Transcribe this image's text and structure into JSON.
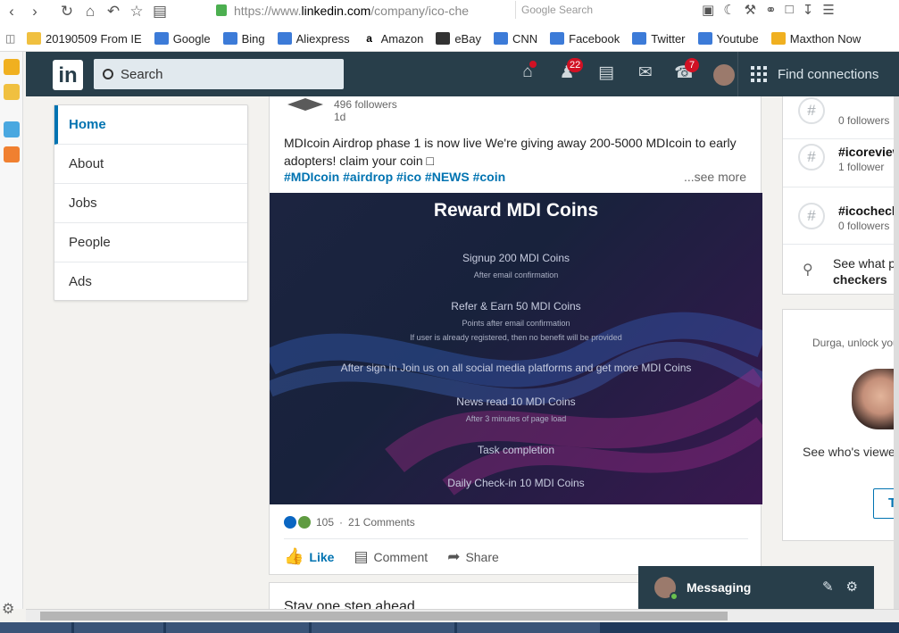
{
  "browser": {
    "url_proto": "https://www.",
    "url_host": "linkedin.com",
    "url_path": "/company/ico-che",
    "search_placeholder": "Google Search",
    "bookmarks": [
      "20190509 From IE",
      "Google",
      "Bing",
      "Aliexpress",
      "Amazon",
      "eBay",
      "CNN",
      "Facebook",
      "Twitter",
      "Youtube",
      "Maxthon Now"
    ]
  },
  "header": {
    "logo": "in",
    "search_placeholder": "Search",
    "network_badge": "22",
    "notifications_badge": "7",
    "find_connections": "Find connections"
  },
  "left_nav": {
    "items": [
      "Home",
      "About",
      "Jobs",
      "People",
      "Ads"
    ]
  },
  "post": {
    "followers": "496 followers",
    "time": "1d",
    "text": "MDIcoin Airdrop phase 1 is now live We're giving away 200-5000 MDIcoin to early adopters! claim your coin □",
    "hashtags": "#MDIcoin #airdrop #ico #NEWS #coin",
    "see_more": "...see more",
    "image": {
      "title": "Reward MDI Coins",
      "line1": "Signup 200 MDI Coins",
      "line1_sub": "After email confirmation",
      "line2": "Refer & Earn 50 MDI Coins",
      "line2_sub": "Points after email confirmation",
      "line2_sub2": "If user is already registered, then no benefit will be provided",
      "line3": "After sign in Join us on all social media platforms and get more MDI Coins",
      "line4": "News read 10 MDI Coins",
      "line4_sub": "After 3 minutes of page load",
      "line5": "Task completion",
      "line6": "Daily Check-in 10 MDI Coins"
    },
    "reactions": "105",
    "comments": "21 Comments",
    "like": "Like",
    "comment": "Comment",
    "share": "Share"
  },
  "stay_card": {
    "title": "Stay one step ahead"
  },
  "hashtag_card": {
    "items": [
      {
        "name": "",
        "sub": "0 followers"
      },
      {
        "name": "#icoreview",
        "sub": "1 follower"
      },
      {
        "name": "#icochecke",
        "sub": "0 followers"
      }
    ],
    "see_what_1": "See what p",
    "see_what_2": "checkers"
  },
  "ad_card": {
    "unlock_text": "Durga, unlock you",
    "see_who": "See who's viewe",
    "button": "T"
  },
  "messaging": {
    "label": "Messaging"
  },
  "colors": {
    "brand": "#0073b1",
    "header": "#283e4a",
    "badge": "#d11124"
  }
}
